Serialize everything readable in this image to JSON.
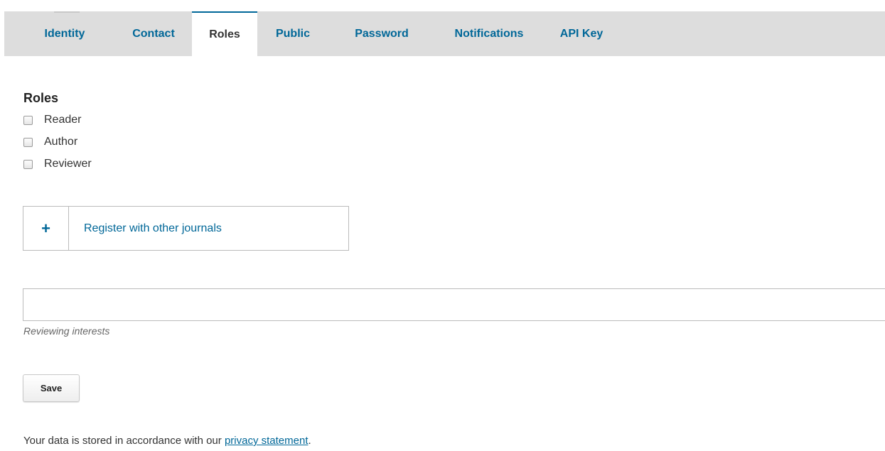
{
  "tabs": {
    "identity": "Identity",
    "contact": "Contact",
    "roles": "Roles",
    "public": "Public",
    "password": "Password",
    "notifications": "Notifications",
    "api_key": "API Key",
    "active": "Roles"
  },
  "roles_section": {
    "heading": "Roles",
    "options": [
      {
        "label": "Reader",
        "checked": false
      },
      {
        "label": "Author",
        "checked": false
      },
      {
        "label": "Reviewer",
        "checked": false
      }
    ]
  },
  "register": {
    "icon": "plus-icon",
    "symbol": "+",
    "label": "Register with other journals"
  },
  "interests": {
    "value": "",
    "label": "Reviewing interests"
  },
  "save_label": "Save",
  "privacy": {
    "text_before": "Your data is stored in accordance with our ",
    "link_text": "privacy statement",
    "text_after": "."
  },
  "colors": {
    "accent": "#006798",
    "tabbar_bg": "#dddddd"
  }
}
